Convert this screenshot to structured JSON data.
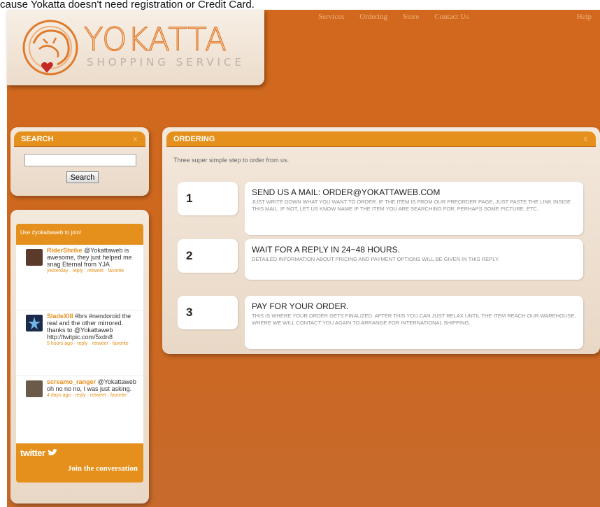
{
  "caption": "cause Yokatta doesn't need registration or Credit Card.",
  "nav": {
    "items": [
      "Services",
      "Ordering",
      "Store",
      "Contact Us"
    ],
    "help": "Help"
  },
  "logo": {
    "title": "YOKATTA",
    "subtitle": "SHOPPING SERVICE",
    "colors": {
      "orange": "#e07a2a",
      "heart": "#c42a22"
    }
  },
  "search": {
    "title": "SEARCH",
    "close": "x",
    "button": "Search",
    "value": ""
  },
  "twitter": {
    "header": "Use #yokattaweb to join!",
    "tweets": [
      {
        "user": "RiderShrike",
        "text": "@Yokattaweb is awesome, they just helped me snag Eternal from YJA",
        "meta": "yesterday · reply · retweet · favorite",
        "avatar_color": "#5a3a2a"
      },
      {
        "user": "SladeXIII",
        "text": "#brs #nendoroid the real and the other mirrored. thanks to @Yokattaweb http://twitpic.com/5xdn8",
        "meta": "5 hours ago · reply · retweet · favorite",
        "avatar_color": "#1b2a4a"
      },
      {
        "user": "screamo_ranger",
        "text": "@Yokattaweb oh no no no, I was just asking.",
        "meta": "4 days ago · reply · retweet · favorite",
        "avatar_color": "#6b5a4a"
      }
    ],
    "logo": "twitter",
    "join": "Join the conversation"
  },
  "ordering": {
    "title": "ORDERING",
    "close": "x",
    "intro": "Three super simple step to order from us.",
    "steps": [
      {
        "num": "1",
        "title": "SEND US A MAIL: ORDER@YOKATTAWEB.COM",
        "desc": "JUST WRITE DOWN WHAT YOU WANT TO ORDER. IF THE ITEM IS FROM OUR PREORDER PAGE, JUST PASTE THE LINK INSIDE THIS MAIL. IF NOT, LET US KNOW NAME IF THE ITEM YOU ARE SEARCHING FOR, PERHAPS SOME PICTURE, ETC."
      },
      {
        "num": "2",
        "title": "WAIT FOR A REPLY IN 24~48 HOURS.",
        "desc": "DETAILED INFORMATION ABOUT PRICING AND PAYMENT OPTIONS WILL BE GIVEN IN THIS REPLY."
      },
      {
        "num": "3",
        "title": "PAY FOR YOUR ORDER.",
        "desc": "THIS IS WHERE YOUR ORDER GETS FINALIZED. AFTER THIS YOU CAN JUST RELAX UNTIL THE ITEM REACH OUR WAREHOUSE, WHERE WE WILL CONTACT YOU AGAIN TO ARRANGE FOR INTERNATIONAL SHIPPING."
      }
    ]
  },
  "colors": {
    "background": "#d2681d",
    "accent": "#e5901c",
    "panel": "#f3e8dc"
  }
}
